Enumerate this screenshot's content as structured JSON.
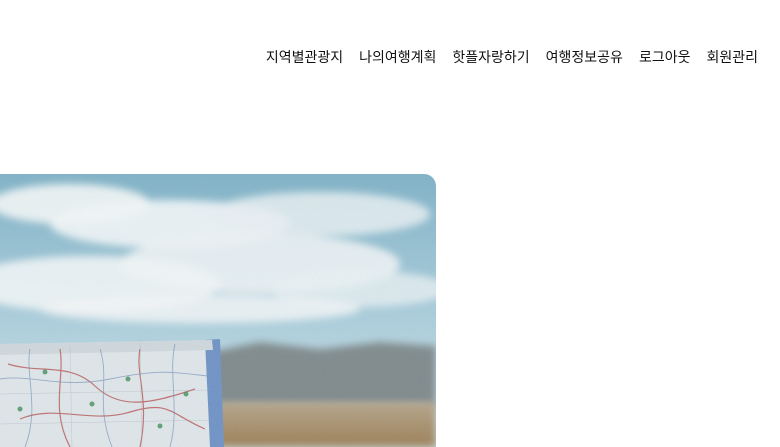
{
  "nav": {
    "items": [
      {
        "label": "지역별관광지"
      },
      {
        "label": "나의여행계획"
      },
      {
        "label": "핫플자랑하기"
      },
      {
        "label": "여행정보공유"
      },
      {
        "label": "로그아웃"
      },
      {
        "label": "회원관리"
      }
    ]
  },
  "hero": {
    "image": "travel-map-photo"
  },
  "colors": {
    "sky_top": "#7fb2c7",
    "sky_bottom": "#b9d7e3",
    "cloud": "#eef4f6",
    "mountain": "#7f8a8c",
    "ground": "#b89b72",
    "map_paper": "#dfe6ea",
    "map_edge": "#6f93c6"
  }
}
